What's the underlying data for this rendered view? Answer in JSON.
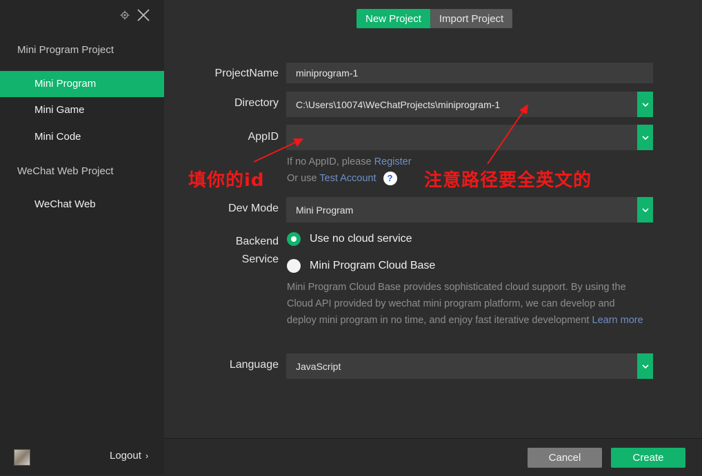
{
  "window": {
    "settings_icon": "gear-icon",
    "close_icon": "close-icon"
  },
  "sidebar": {
    "sections": [
      {
        "title": "Mini Program Project",
        "items": [
          {
            "label": "Mini Program",
            "active": true
          },
          {
            "label": "Mini Game",
            "active": false
          },
          {
            "label": "Mini Code",
            "active": false
          }
        ]
      },
      {
        "title": "WeChat Web Project",
        "items": [
          {
            "label": "WeChat Web",
            "active": false
          }
        ]
      }
    ],
    "logout_label": "Logout",
    "logout_chevron": "›"
  },
  "tabs": [
    {
      "label": "New Project",
      "active": true
    },
    {
      "label": "Import Project",
      "active": false
    }
  ],
  "form": {
    "project_name": {
      "label": "ProjectName",
      "value": "miniprogram-1"
    },
    "directory": {
      "label": "Directory",
      "value": "C:\\Users\\10074\\WeChatProjects\\miniprogram-1"
    },
    "appid": {
      "label": "AppID",
      "value": "",
      "hint_no_appid": "If no AppID, please",
      "register_link": "Register",
      "hint_or_use": "Or use",
      "test_account_link": "Test Account",
      "help_glyph": "?"
    },
    "dev_mode": {
      "label": "Dev Mode",
      "value": "Mini Program"
    },
    "backend": {
      "label_line1": "Backend",
      "label_line2": "Service",
      "options": [
        {
          "label": "Use no cloud service",
          "checked": true
        },
        {
          "label": "Mini Program Cloud Base",
          "checked": false
        }
      ],
      "description": "Mini Program Cloud Base provides sophisticated cloud support. By using the Cloud API provided by wechat mini program platform, we can develop and deploy mini program in no time, and enjoy fast iterative development",
      "learn_more": "Learn more"
    },
    "language": {
      "label": "Language",
      "value": "JavaScript"
    }
  },
  "annotations": {
    "appid_note": "填你的id",
    "path_note": "注意路径要全英文的",
    "color": "#f01818"
  },
  "footer": {
    "cancel_label": "Cancel",
    "create_label": "Create"
  },
  "colors": {
    "accent": "#11b36d",
    "link": "#6f8fc4",
    "background": "#2e2e2e",
    "sidebar": "#262626"
  }
}
